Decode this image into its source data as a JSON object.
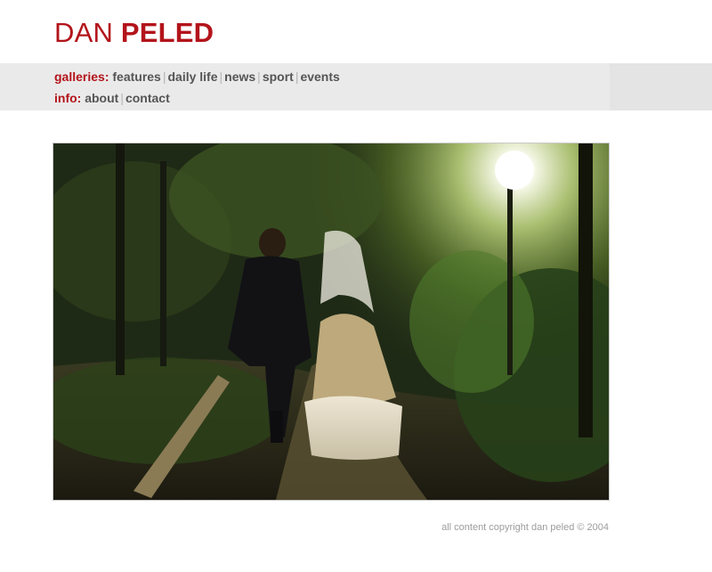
{
  "header": {
    "name_first": "DAN",
    "name_last": "PELED"
  },
  "nav": {
    "galleries_label": "galleries:",
    "galleries": [
      {
        "label": "features"
      },
      {
        "label": "daily life"
      },
      {
        "label": "news"
      },
      {
        "label": "sport"
      },
      {
        "label": "events"
      }
    ],
    "info_label": "info:",
    "info": [
      {
        "label": "about"
      },
      {
        "label": "contact"
      }
    ],
    "separator": "|"
  },
  "footer": {
    "copyright": "all content copyright dan peled © 2004"
  },
  "colors": {
    "brand_red": "#b3141b",
    "nav_link": "#555555",
    "nav_band": "#eaeaea"
  }
}
